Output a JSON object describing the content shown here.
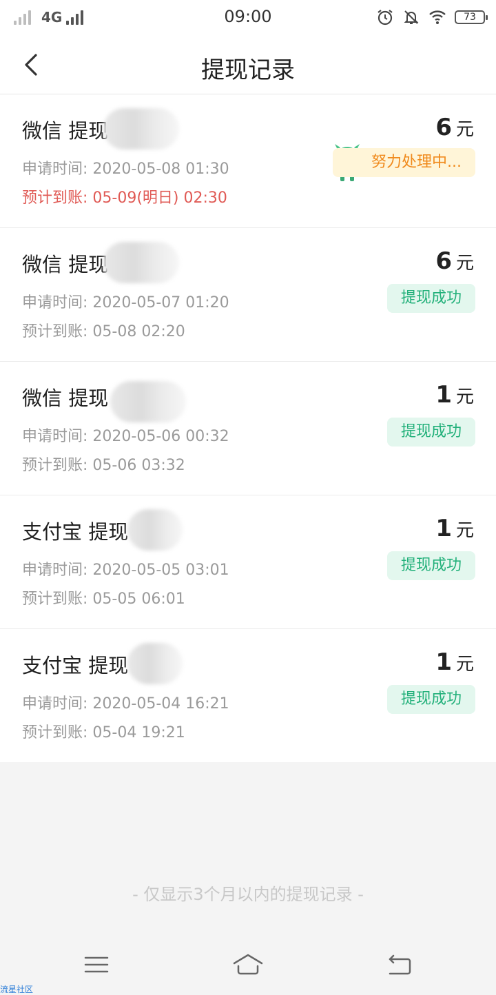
{
  "status_bar": {
    "network": "4G",
    "time": "09:00",
    "battery": "73"
  },
  "nav": {
    "title": "提现记录"
  },
  "records": [
    {
      "title": "微信 提现",
      "apply": "申请时间: 2020-05-08 01:30",
      "expect": "预计到账: 05-09(明日) 02:30",
      "amount": "6",
      "unit": "元",
      "status": "努力处理中..."
    },
    {
      "title": "微信 提现",
      "apply": "申请时间: 2020-05-07 01:20",
      "expect": "预计到账: 05-08 02:20",
      "amount": "6",
      "unit": "元",
      "status": "提现成功"
    },
    {
      "title": "微信 提现",
      "apply": "申请时间: 2020-05-06 00:32",
      "expect": "预计到账: 05-06 03:32",
      "amount": "1",
      "unit": "元",
      "status": "提现成功"
    },
    {
      "title": "支付宝 提现",
      "apply": "申请时间: 2020-05-05 03:01",
      "expect": "预计到账: 05-05 06:01",
      "amount": "1",
      "unit": "元",
      "status": "提现成功"
    },
    {
      "title": "支付宝 提现",
      "apply": "申请时间: 2020-05-04 16:21",
      "expect": "预计到账: 05-04 19:21",
      "amount": "1",
      "unit": "元",
      "status": "提现成功"
    }
  ],
  "footer_note": "- 仅显示3个月以内的提现记录 -",
  "watermark": "流星社区",
  "colors": {
    "success": "#22b07a",
    "processing": "#f08a1c",
    "expect_pending": "#e05a55"
  }
}
